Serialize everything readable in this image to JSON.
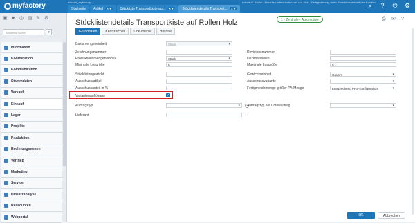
{
  "app": {
    "logo": "myfactory",
    "user_info": "wilcode_myfactory",
    "system_info": "Lokale AI-Suche · Aktuelle Umfeld laufen und v.o. Holz · Fertigmeldung · kein Produktionsbedarf des Kunden"
  },
  "tabs": [
    {
      "label": "Startseite"
    },
    {
      "label": "Artikel"
    },
    {
      "label": "Stückliste Transportkiste au..."
    },
    {
      "label": "Stücklistendetails Transport..."
    }
  ],
  "topicons": [
    "search-icon",
    "help-icon",
    "power-icon",
    "settings-icon"
  ],
  "sidebar": {
    "search_placeholder": "Business Suche",
    "items": [
      {
        "label": "Information"
      },
      {
        "label": "Koordination"
      },
      {
        "label": "Kommunikation"
      },
      {
        "label": "Stammdaten"
      },
      {
        "label": "Verkauf"
      },
      {
        "label": "Einkauf"
      },
      {
        "label": "Lager"
      },
      {
        "label": "Projekte"
      },
      {
        "label": "Produktion"
      },
      {
        "label": "Rechnungswesen"
      },
      {
        "label": "Vertrieb"
      },
      {
        "label": "Marketing"
      },
      {
        "label": "Service"
      },
      {
        "label": "Umsatzanalyse"
      },
      {
        "label": "Ressourcen"
      },
      {
        "label": "Webportal"
      }
    ]
  },
  "main": {
    "title": "Stücklistendetails Transportkiste auf Rollen Holz",
    "badge": "1 - Zentrale - Automotive",
    "subtabs": [
      {
        "label": "Grunddaten"
      },
      {
        "label": "Kennzeichen"
      },
      {
        "label": "Dokumente"
      },
      {
        "label": "Historie"
      }
    ],
    "left_fields": [
      {
        "label": "Basismengeneinheit",
        "value": "Stück"
      },
      {
        "label": "Zeichnungsnummer",
        "value": ""
      },
      {
        "label": "Produktionsmengeneinheit",
        "value": "Stück"
      },
      {
        "label": "Minimale Losgröße",
        "value": "0"
      },
      {
        "label": "Stücklistengewicht",
        "value": ""
      },
      {
        "label": "Ausschussartikel",
        "value": ""
      },
      {
        "label": "Ausschussanteil in %",
        "value": ""
      },
      {
        "label": "Variantenauflösung",
        "value": ""
      },
      {
        "label": "Auftragstyp",
        "value": ""
      },
      {
        "label": "Lieferant",
        "value": ""
      }
    ],
    "right_fields": [
      {
        "label": "Revisionsnummer",
        "value": ""
      },
      {
        "label": "Dezimalstellen",
        "value": ""
      },
      {
        "label": "Maximale Losgröße",
        "value": "0"
      },
      {
        "label": "Gewichtseinheit",
        "value": "Gramm"
      },
      {
        "label": "Ausschussvariante",
        "value": ""
      },
      {
        "label": "Fertigmeldemenge größer PA-Menge",
        "value": "Entsprechend PPS-Konfiguration"
      },
      {
        "label": "Auftragstyp bei Unterauftrag",
        "value": ""
      }
    ],
    "buttons": {
      "ok": "OK",
      "cancel": "Abbrechen"
    },
    "checkbox": "✓",
    "info": "i",
    "ellipsis": "..."
  }
}
